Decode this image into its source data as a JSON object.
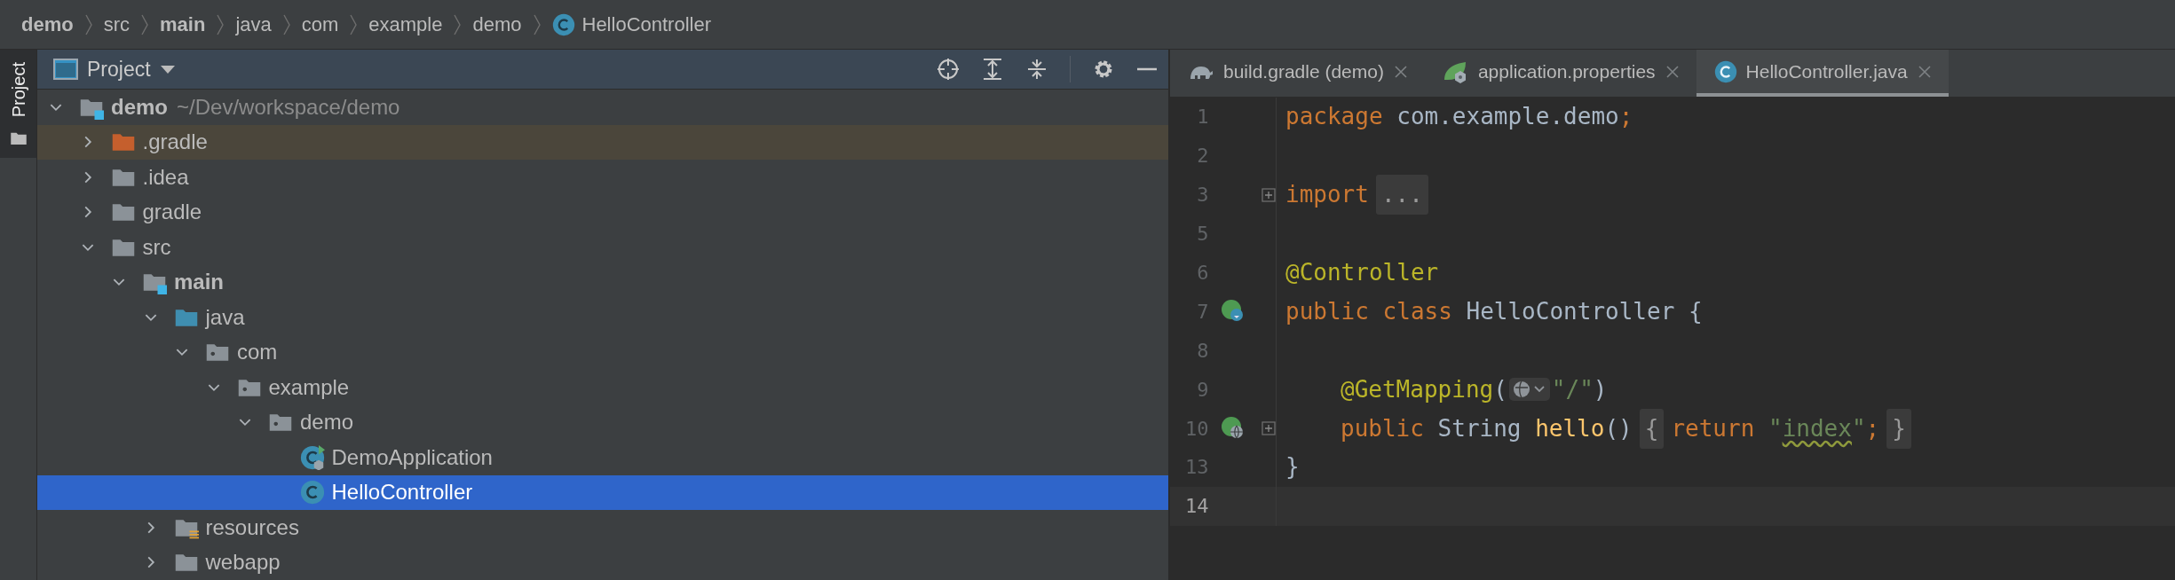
{
  "breadcrumbs": [
    {
      "label": "demo",
      "kind": "module"
    },
    {
      "label": "src",
      "kind": "folder"
    },
    {
      "label": "main",
      "kind": "module"
    },
    {
      "label": "java",
      "kind": "folder"
    },
    {
      "label": "com",
      "kind": "folder"
    },
    {
      "label": "example",
      "kind": "folder"
    },
    {
      "label": "demo",
      "kind": "folder"
    },
    {
      "label": "HelloController",
      "kind": "class"
    }
  ],
  "tool_stripe": [
    {
      "label": "Project",
      "selected": true
    }
  ],
  "project_panel": {
    "title": "Project",
    "tree": [
      {
        "label": "demo",
        "path": "~/Dev/workspace/demo",
        "kind": "module",
        "expanded": true,
        "selected": false,
        "highlighted": false,
        "children": [
          {
            "label": ".gradle",
            "kind": "excluded-folder",
            "expanded": false,
            "selected": false,
            "highlighted": true
          },
          {
            "label": ".idea",
            "kind": "folder",
            "expanded": false,
            "selected": false,
            "highlighted": false
          },
          {
            "label": "gradle",
            "kind": "folder",
            "expanded": false,
            "selected": false,
            "highlighted": false
          },
          {
            "label": "src",
            "kind": "folder",
            "expanded": true,
            "selected": false,
            "highlighted": false,
            "children": [
              {
                "label": "main",
                "kind": "module",
                "expanded": true,
                "selected": false,
                "highlighted": false,
                "children": [
                  {
                    "label": "java",
                    "kind": "source-root",
                    "expanded": true,
                    "selected": false,
                    "highlighted": false,
                    "children": [
                      {
                        "label": "com",
                        "kind": "package",
                        "expanded": true,
                        "selected": false,
                        "highlighted": false,
                        "children": [
                          {
                            "label": "example",
                            "kind": "package",
                            "expanded": true,
                            "selected": false,
                            "highlighted": false,
                            "children": [
                              {
                                "label": "demo",
                                "kind": "package",
                                "expanded": true,
                                "selected": false,
                                "highlighted": false,
                                "children": [
                                  {
                                    "label": "DemoApplication",
                                    "kind": "spring-app-class",
                                    "selected": false,
                                    "highlighted": false
                                  },
                                  {
                                    "label": "HelloController",
                                    "kind": "class",
                                    "selected": true,
                                    "highlighted": false
                                  }
                                ]
                              }
                            ]
                          }
                        ]
                      }
                    ]
                  },
                  {
                    "label": "resources",
                    "kind": "resources-root",
                    "expanded": false,
                    "selected": false,
                    "highlighted": false
                  },
                  {
                    "label": "webapp",
                    "kind": "folder",
                    "expanded": false,
                    "selected": false,
                    "highlighted": false
                  }
                ]
              }
            ]
          }
        ]
      }
    ]
  },
  "editor_tabs": [
    {
      "label": "build.gradle (demo)",
      "kind": "gradle",
      "selected": false
    },
    {
      "label": "application.properties",
      "kind": "spring-properties",
      "selected": false
    },
    {
      "label": "HelloController.java",
      "kind": "class",
      "selected": true
    }
  ],
  "code_lines": [
    {
      "number": "1",
      "current": false,
      "indented": false,
      "fold": false,
      "tokens": [
        {
          "kind": "keyword",
          "text": "package"
        },
        {
          "kind": "plain",
          "text": " com.example.demo"
        },
        {
          "kind": "keyword",
          "text": ";"
        }
      ]
    },
    {
      "number": "2",
      "current": false
    },
    {
      "number": "3",
      "current": false,
      "indented": false,
      "fold": true,
      "tokens": [
        {
          "kind": "keyword",
          "text": "import"
        },
        {
          "kind": "folded",
          "text": "..."
        }
      ]
    },
    {
      "number": "5",
      "current": false
    },
    {
      "number": "6",
      "current": false,
      "indented": false,
      "fold": false,
      "tokens": [
        {
          "kind": "annotation",
          "text": "@Controller"
        }
      ]
    },
    {
      "number": "7",
      "current": false,
      "indented": false,
      "fold": false,
      "gutter_icon": {
        "kind": "bean"
      },
      "tokens": [
        {
          "kind": "keyword",
          "text": "public"
        },
        {
          "kind": "keyword",
          "text": " class"
        },
        {
          "kind": "plain",
          "text": " HelloController {"
        }
      ]
    },
    {
      "number": "8",
      "current": false
    },
    {
      "number": "9",
      "current": false,
      "indented": true,
      "fold": false,
      "tokens": [
        {
          "kind": "annotation",
          "text": "@GetMapping"
        },
        {
          "kind": "plain",
          "text": "("
        },
        {
          "kind": "url-inlay"
        },
        {
          "kind": "string",
          "text": "\"/\""
        },
        {
          "kind": "plain",
          "text": ")"
        }
      ]
    },
    {
      "number": "10",
      "current": false,
      "indented": true,
      "fold": true,
      "gutter_icon": {
        "kind": "web"
      },
      "tokens": [
        {
          "kind": "keyword",
          "text": "public"
        },
        {
          "kind": "plain",
          "text": " String "
        },
        {
          "kind": "method",
          "text": "hello"
        },
        {
          "kind": "plain",
          "text": "()"
        },
        {
          "kind": "folded",
          "text": "{"
        },
        {
          "kind": "keyword",
          "text": "return"
        },
        {
          "kind": "string",
          "text": " \""
        },
        {
          "kind": "typo",
          "text": "index"
        },
        {
          "kind": "string",
          "text": "\""
        },
        {
          "kind": "keyword",
          "text": ";"
        },
        {
          "kind": "folded",
          "text": "}"
        }
      ]
    },
    {
      "number": "13",
      "current": false,
      "indented": false,
      "fold": false,
      "tokens": [
        {
          "kind": "plain",
          "text": "}"
        }
      ]
    },
    {
      "number": "14",
      "current": true
    }
  ]
}
